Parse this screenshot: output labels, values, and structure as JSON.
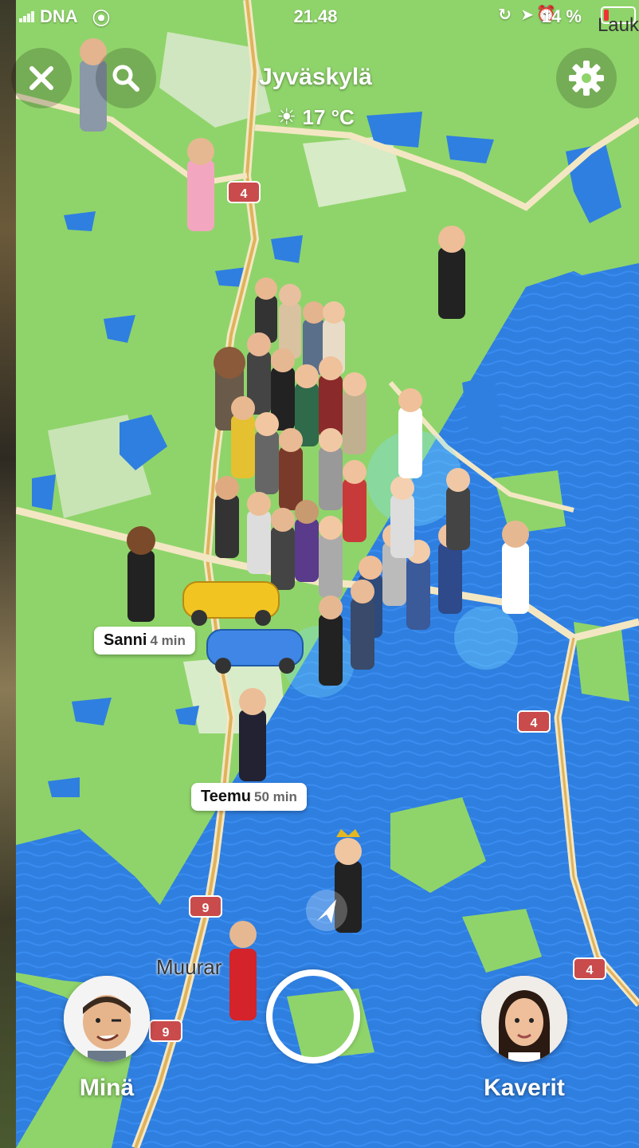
{
  "status": {
    "carrier": "DNA",
    "time": "21.48",
    "battery": "14 %",
    "corner_text": "Lauk"
  },
  "header": {
    "city": "Jyväskylä",
    "temperature": "17 °C",
    "weather_icon": "sun-icon"
  },
  "map": {
    "road_badges": [
      "4",
      "4",
      "4",
      "9",
      "9"
    ],
    "place_label": "Muurar",
    "friend_tags": [
      {
        "name": "Sanni",
        "time": "4 min"
      },
      {
        "name": "Teemu",
        "time": "50 min"
      }
    ]
  },
  "bottom": {
    "me_label": "Minä",
    "friends_label": "Kaverit"
  },
  "colors": {
    "land": "#8fd46a",
    "water": "#2f7fe0",
    "road": "#f0e6c8",
    "badge": "#c94b4b"
  }
}
